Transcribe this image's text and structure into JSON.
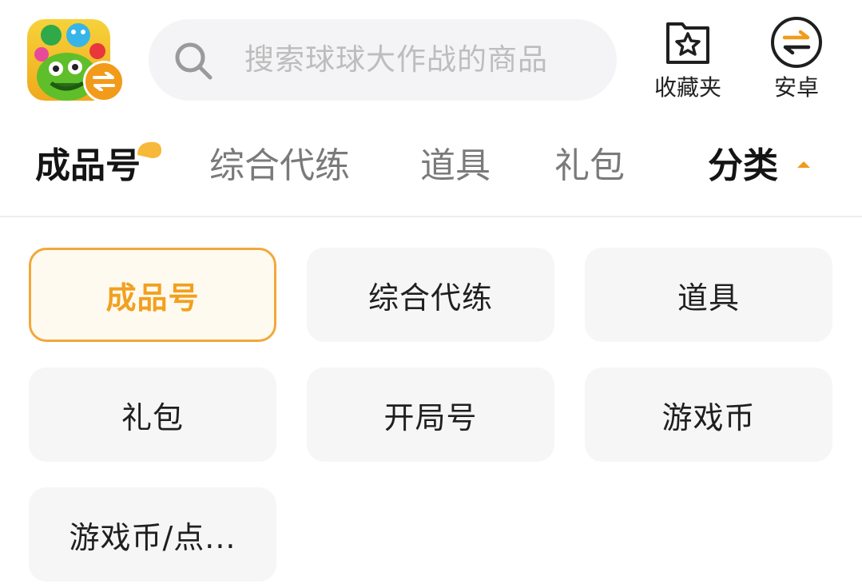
{
  "header": {
    "search_placeholder": "搜索球球大作战的商品",
    "favorites_label": "收藏夹",
    "platform_label": "安卓"
  },
  "tabs": [
    {
      "label": "成品号",
      "active": true
    },
    {
      "label": "综合代练",
      "active": false
    },
    {
      "label": "道具",
      "active": false
    },
    {
      "label": "礼包",
      "active": false
    }
  ],
  "category_tab": {
    "label": "分类"
  },
  "categories": [
    {
      "label": "成品号",
      "selected": true
    },
    {
      "label": "综合代练",
      "selected": false
    },
    {
      "label": "道具",
      "selected": false
    },
    {
      "label": "礼包",
      "selected": false
    },
    {
      "label": "开局号",
      "selected": false
    },
    {
      "label": "游戏币",
      "selected": false
    },
    {
      "label": "游戏币/点...",
      "selected": false
    }
  ],
  "colors": {
    "accent": "#f29a1a",
    "selected_border": "#f2a83a",
    "selected_bg": "#fffaef",
    "item_bg": "#f6f6f6",
    "search_bg": "#f4f4f6"
  },
  "icons": [
    "app-icon",
    "swap-icon",
    "search-icon",
    "star-folder-icon",
    "android-switch-icon",
    "caret-up-icon"
  ]
}
